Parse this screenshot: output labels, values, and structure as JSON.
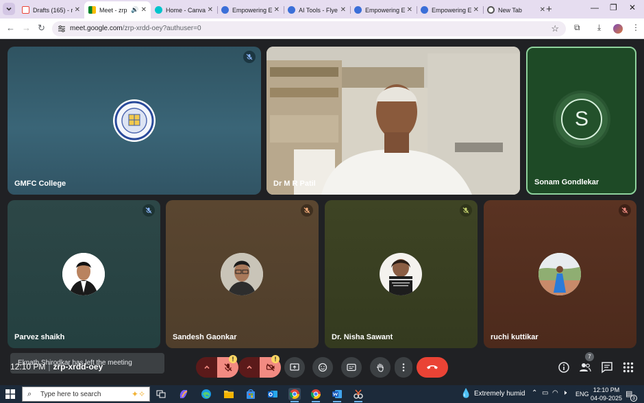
{
  "browser": {
    "tabs": [
      {
        "label": "Drafts (165) - r",
        "icon": "gmail-icon",
        "color": "#ea4335"
      },
      {
        "label": "Meet - zrp",
        "icon": "meet-icon",
        "color": "#00897b",
        "active": true,
        "audio": true
      },
      {
        "label": "Home - Canva",
        "icon": "canva-icon",
        "color": "#00c4cc"
      },
      {
        "label": "Empowering E",
        "icon": "globe-icon",
        "color": "#3b6fd8"
      },
      {
        "label": "AI Tools - Flye",
        "icon": "globe-icon",
        "color": "#3b6fd8"
      },
      {
        "label": "Empowering E",
        "icon": "globe-icon",
        "color": "#3b6fd8"
      },
      {
        "label": "Empowering E",
        "icon": "globe-icon",
        "color": "#3b6fd8"
      },
      {
        "label": "New Tab",
        "icon": "chrome-icon",
        "color": "#555555"
      }
    ],
    "url_host": "meet.google.com",
    "url_path": "/zrp-xrdd-oey?authuser=0"
  },
  "tiles": {
    "gmfc": {
      "name": "GMFC College"
    },
    "patil": {
      "name": "Dr M R Patil"
    },
    "sonam": {
      "name": "Sonam Gondlekar",
      "initial": "S"
    },
    "parvez": {
      "name": "Parvez shaikh"
    },
    "sandesh": {
      "name": "Sandesh Gaonkar"
    },
    "nisha": {
      "name": "Dr. Nisha Sawant"
    },
    "ruchi": {
      "name": "ruchi kuttikar"
    }
  },
  "toast": {
    "text": "Eknath Shirodkar has left the meeting"
  },
  "meeting": {
    "time": "12:10 PM",
    "separator": "|",
    "code": "zrp-xrdd-oey",
    "participant_count": "7",
    "badge": "!"
  },
  "colors": {
    "leave": "#ea4335",
    "mic_off": "#f28b82",
    "accent_green": "#8fd29d"
  },
  "taskbar": {
    "search_placeholder": "Type here to search",
    "weather": "Extremely humid",
    "language": "ENG",
    "time": "12:10 PM",
    "date": "04-09-2025",
    "notification_count": "3"
  }
}
